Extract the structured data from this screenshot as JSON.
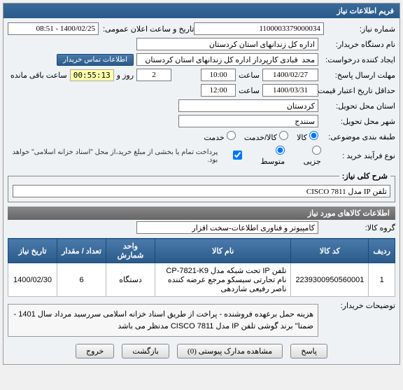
{
  "panel_title": "فریم اطلاعات نیاز",
  "fields": {
    "req_no_label": "شماره نیاز:",
    "req_no": "1100003379000034",
    "pub_date_label": "تاریخ و ساعت اعلان عمومی:",
    "pub_date": "1400/02/25 - 08:51",
    "buyer_org_label": "نام دستگاه خریدار:",
    "buyer_org": "اداره کل زندانهای استان کردستان",
    "creator_label": "ایجاد کننده درخواست:",
    "creator": "مجد  قبادی کارپرداز اداره کل زندانهای استان کردستان",
    "contact_btn": "اطلاعات تماس خریدار",
    "deadline_label": "مهلت ارسال پاسخ:",
    "deadline_date": "1400/02/27",
    "hour_word": "ساعت",
    "deadline_time": "10:00",
    "day_word": "روز و",
    "days_val": "2",
    "countdown": "00:55:13",
    "remaining": "ساعت باقی مانده",
    "valid_label": "حداقل تاریخ اعتبار قیمت: تا تاریخ:",
    "valid_date": "1400/03/31",
    "valid_time": "12:00",
    "province_label": "استان محل تحویل:",
    "province": "کردستان",
    "city_label": "شهر محل تحویل:",
    "city": "سنندج",
    "pkg_label": "طبقه بندی موضوعی:",
    "opt_kala": "کالا",
    "opt_service": "کالا/خدمت",
    "opt_supply": "خدمت",
    "proc_label": "نوع فرآیند خرید :",
    "opt_jozi": "جزیی",
    "opt_mid": "متوسط",
    "opt_mid2": "",
    "pay_note": "پرداخت تمام یا بخشی از مبلغ خرید،از محل \"اسناد خزانه اسلامی\" خواهد بود.",
    "summary_legend": "شرح کلی نیاز:",
    "summary": "تلفن IP مدل CISCO 7811"
  },
  "items_section": "اطلاعات کالاهای مورد نیاز",
  "group_label": "گروه کالا:",
  "group_value": "کامپیوتر و فناوری اطلاعات-سخت افزار",
  "table": {
    "headers": [
      "ردیف",
      "کد کالا",
      "نام کالا",
      "واحد شمارش",
      "تعداد / مقدار",
      "تاریخ نیاز"
    ],
    "rows": [
      {
        "idx": "1",
        "code": "2239300950560001",
        "name": "تلفن IP تحت شبکه مدل CP-7821-K9 نام تجارتی سیسکو مرجع عرضه کننده ناصر رفیعی شازدهی",
        "unit": "دستگاه",
        "qty": "6",
        "date": "1400/02/30"
      }
    ]
  },
  "notes_label": "توضیحات خریدار:",
  "notes_text": "هزینه  حمل برعهده فروشنده - پراخت از طریق اسناد خزانه اسلامی سررسید مرداد سال 1401  - ضمنا\"  برند گوشی تلفن IP مدل   CISCO 7811 مدنظر می باشد",
  "footer": {
    "reply": "پاسخ",
    "attach": "مشاهده مدارک پیوستی (0)",
    "back": "بازگشت",
    "close": "خروج"
  }
}
